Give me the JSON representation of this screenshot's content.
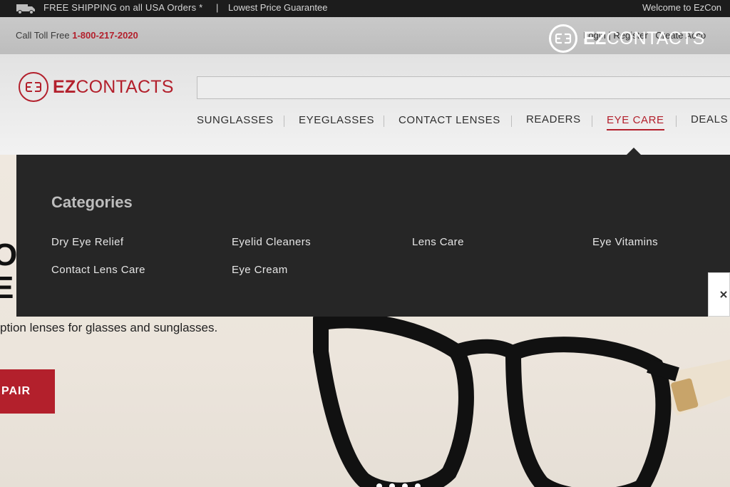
{
  "topbar": {
    "shipping": "FREE SHIPPING on all USA Orders *",
    "separator": "|",
    "lowest_price": "Lowest Price Guarantee",
    "welcome": "Welcome to EzCon"
  },
  "strip": {
    "toll_label": "Call Toll Free",
    "phone": "1-800-217-2020",
    "account_links": "Login  |  Register  |  Create Acco"
  },
  "overlay_logo": {
    "bold": "EZ",
    "rest": "CONTACTS"
  },
  "brand": {
    "bold": "EZ",
    "rest": "CONTACTS"
  },
  "search": {
    "placeholder": ""
  },
  "nav": {
    "items": [
      {
        "label": "SUNGLASSES"
      },
      {
        "label": "EYEGLASSES"
      },
      {
        "label": "CONTACT LENSES"
      },
      {
        "label": "READERS"
      },
      {
        "label": "EYE CARE"
      },
      {
        "label": "DEALS"
      }
    ],
    "active": "EYE CARE"
  },
  "dropdown": {
    "title": "Categories",
    "links": [
      {
        "label": "Dry Eye Relief"
      },
      {
        "label": "Eyelid Cleaners"
      },
      {
        "label": "Lens Care"
      },
      {
        "label": "Eye Vitamins"
      },
      {
        "label": "Contact Lens Care"
      },
      {
        "label": "Eye Cream"
      }
    ]
  },
  "hero": {
    "line1": "O",
    "line2": "E",
    "tagline": "ption lenses for glasses and sunglasses.",
    "cta": "PAIR"
  },
  "icons": {
    "shipping": "truck-icon",
    "logo": "ez-logo-icon",
    "close": "close-icon"
  },
  "colors": {
    "brand_red": "#b3202c",
    "topbar": "#1c1c1c",
    "dropdown": "#262626"
  }
}
